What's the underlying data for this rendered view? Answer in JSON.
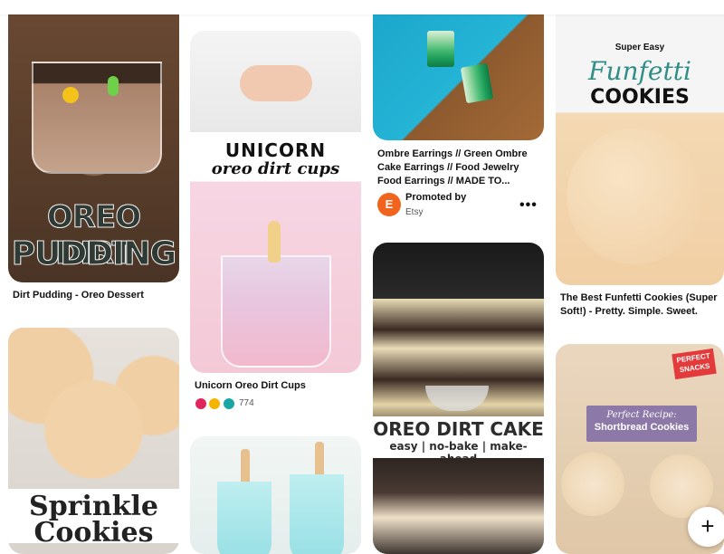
{
  "pins": {
    "oreo_pudding": {
      "image_text_1": "OREO DIRT",
      "image_text_2": "PUDDING",
      "caption": "Dirt Pudding - Oreo Dessert"
    },
    "sprinkle_cookies": {
      "image_text": "Sprinkle",
      "image_text_2": "Cookies"
    },
    "unicorn_cups": {
      "image_text_1": "UNICORN",
      "image_text_2": "oreo dirt cups",
      "caption": "Unicorn Oreo Dirt Cups",
      "reaction_count": "774"
    },
    "earrings": {
      "caption": "Ombre Earrings // Green Ombre Cake Earrings // Food Jewelry Food Earrings // MADE TO...",
      "avatar_letter": "E",
      "promoted_label": "Promoted by",
      "promoter": "Etsy",
      "more": "•••"
    },
    "dirt_cake": {
      "image_text_1": "OREO DIRT CAKE",
      "image_text_2": "easy | no-bake | make-ahead"
    },
    "funfetti": {
      "image_text_1": "Super Easy",
      "image_text_2": "Funfetti",
      "image_text_3": "COOKIES",
      "caption": "The Best Funfetti Cookies (Super Soft!) - Pretty. Simple. Sweet."
    },
    "shortbread": {
      "logo_text": "PERFECT SNACKS",
      "badge_1": "Perfect Recipe:",
      "badge_2": "Shortbread Cookies"
    }
  },
  "fab": {
    "label": "+"
  },
  "colors": {
    "etsy_orange": "#f1641e",
    "funfetti_teal": "#2f8f86",
    "badge_purple": "#8d79a8"
  }
}
